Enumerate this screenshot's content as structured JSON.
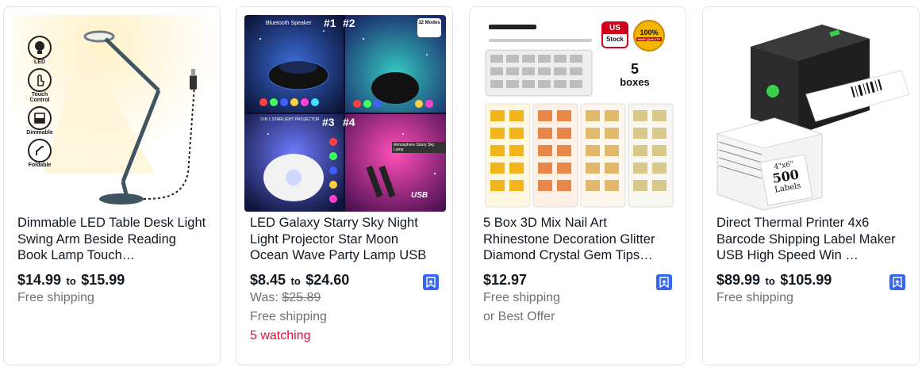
{
  "listings": [
    {
      "title": "Dimmable LED Table Desk Light Swing Arm Beside Reading Book Lamp Touch…",
      "price_low": "$14.99",
      "price_to": "to",
      "price_high": "$15.99",
      "shipping": "Free shipping",
      "image": {
        "features": [
          "LED",
          "Touch Control",
          "Dimmable",
          "Foldable"
        ]
      }
    },
    {
      "title": "LED Galaxy Starry Sky Night Light Projector Star Moon Ocean Wave Party Lamp USB",
      "price_low": "$8.45",
      "price_to": "to",
      "price_high": "$24.60",
      "was_label": "Was: ",
      "was_price": "$25.89",
      "shipping": "Free shipping",
      "watching": "5 watching",
      "image": {
        "panel_labels": [
          "#1",
          "#2",
          "#3",
          "#4"
        ],
        "bluetooth": "Bluetooth Speaker",
        "modes": "32 Modes",
        "three_in_one": "3 IN 1 STARLIGHT PROJECTOR",
        "atmosphere": "Atmosphere Starry Sky Lamp",
        "usb": "USB"
      }
    },
    {
      "title": "5 Box 3D Mix Nail Art Rhinestone Decoration Glitter Diamond Crystal Gem Tips…",
      "price": "$12.97",
      "shipping": "Free shipping",
      "best_offer": "or Best Offer",
      "image": {
        "us_stock_1": "US",
        "us_stock_2": "Stock",
        "quality_1": "100%",
        "quality_2": "HIGH QUALITY",
        "boxes_num": "5",
        "boxes_word": "boxes"
      }
    },
    {
      "title": "Direct Thermal Printer 4x6 Barcode Shipping Label Maker USB High Speed Win …",
      "price_low": "$89.99",
      "price_to": "to",
      "price_high": "$105.99",
      "shipping": "Free shipping",
      "image": {
        "labels_size": "4\"x6\"",
        "labels_count": "500",
        "labels_word": "Labels"
      }
    }
  ],
  "colors": {
    "save_button": "#3665f3",
    "watching": "#e0103a",
    "secondary_text": "#707070"
  }
}
